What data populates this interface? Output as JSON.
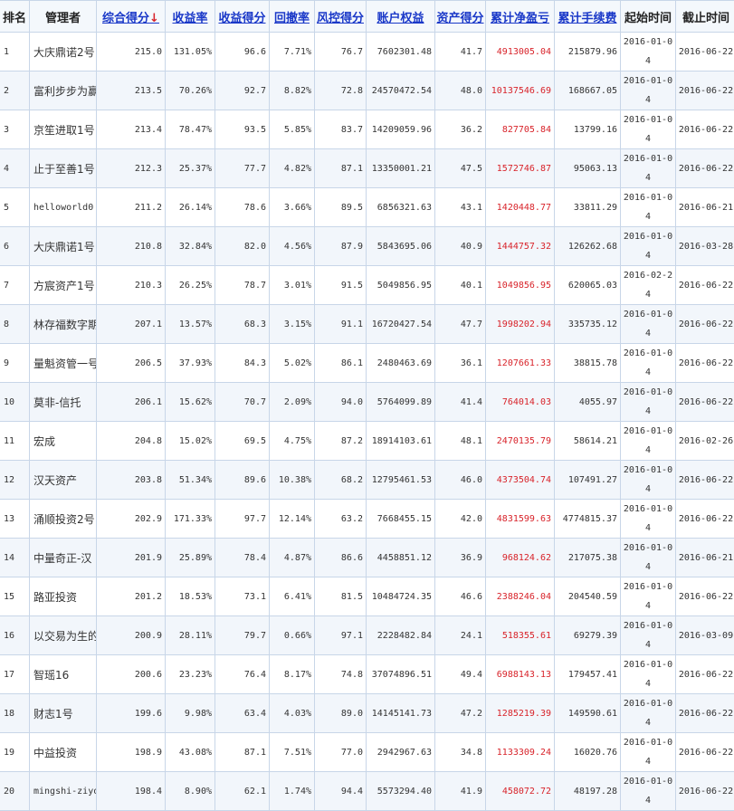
{
  "table": {
    "headers": {
      "rank": "排名",
      "manager": "管理者",
      "total_score": "综合得分",
      "return_rate": "收益率",
      "return_score": "收益得分",
      "drawdown": "回撤率",
      "risk_score": "风控得分",
      "equity": "账户权益",
      "asset_score": "资产得分",
      "pnl": "累计净盈亏",
      "fees": "累计手续费",
      "start_time": "起始时间",
      "end_time": "截止时间"
    },
    "sort_indicator": "↓",
    "rows": [
      {
        "rank": "1",
        "manager": "大庆鼎诺2号",
        "total_score": "215.0",
        "return_rate": "131.05%",
        "return_score": "96.6",
        "drawdown": "7.71%",
        "risk_score": "76.7",
        "equity": "7602301.48",
        "asset_score": "41.7",
        "pnl": "4913005.04",
        "fees": "215879.96",
        "start": "2016-01-04",
        "end": "2016-06-22"
      },
      {
        "rank": "2",
        "manager": "富利步步为赢",
        "total_score": "213.5",
        "return_rate": "70.26%",
        "return_score": "92.7",
        "drawdown": "8.82%",
        "risk_score": "72.8",
        "equity": "24570472.54",
        "asset_score": "48.0",
        "pnl": "10137546.69",
        "fees": "168667.05",
        "start": "2016-01-04",
        "end": "2016-06-22"
      },
      {
        "rank": "3",
        "manager": "京笙进取1号",
        "total_score": "213.4",
        "return_rate": "78.47%",
        "return_score": "93.5",
        "drawdown": "5.85%",
        "risk_score": "83.7",
        "equity": "14209059.96",
        "asset_score": "36.2",
        "pnl": "827705.84",
        "fees": "13799.16",
        "start": "2016-01-04",
        "end": "2016-06-22"
      },
      {
        "rank": "4",
        "manager": "止于至善1号",
        "total_score": "212.3",
        "return_rate": "25.37%",
        "return_score": "77.7",
        "drawdown": "4.82%",
        "risk_score": "87.1",
        "equity": "13350001.21",
        "asset_score": "47.5",
        "pnl": "1572746.87",
        "fees": "95063.13",
        "start": "2016-01-04",
        "end": "2016-06-22"
      },
      {
        "rank": "5",
        "manager": "helloworld0",
        "total_score": "211.2",
        "return_rate": "26.14%",
        "return_score": "78.6",
        "drawdown": "3.66%",
        "risk_score": "89.5",
        "equity": "6856321.63",
        "asset_score": "43.1",
        "pnl": "1420448.77",
        "fees": "33811.29",
        "start": "2016-01-04",
        "end": "2016-06-21"
      },
      {
        "rank": "6",
        "manager": "大庆鼎诺1号",
        "total_score": "210.8",
        "return_rate": "32.84%",
        "return_score": "82.0",
        "drawdown": "4.56%",
        "risk_score": "87.9",
        "equity": "5843695.06",
        "asset_score": "40.9",
        "pnl": "1444757.32",
        "fees": "126262.68",
        "start": "2016-01-04",
        "end": "2016-03-28"
      },
      {
        "rank": "7",
        "manager": "方宸资产1号",
        "total_score": "210.3",
        "return_rate": "26.25%",
        "return_score": "78.7",
        "drawdown": "3.01%",
        "risk_score": "91.5",
        "equity": "5049856.95",
        "asset_score": "40.1",
        "pnl": "1049856.95",
        "fees": "620065.03",
        "start": "2016-02-24",
        "end": "2016-06-22"
      },
      {
        "rank": "8",
        "manager": "林存福数字期",
        "total_score": "207.1",
        "return_rate": "13.57%",
        "return_score": "68.3",
        "drawdown": "3.15%",
        "risk_score": "91.1",
        "equity": "16720427.54",
        "asset_score": "47.7",
        "pnl": "1998202.94",
        "fees": "335735.12",
        "start": "2016-01-04",
        "end": "2016-06-22"
      },
      {
        "rank": "9",
        "manager": "量魁资管一号",
        "total_score": "206.5",
        "return_rate": "37.93%",
        "return_score": "84.3",
        "drawdown": "5.02%",
        "risk_score": "86.1",
        "equity": "2480463.69",
        "asset_score": "36.1",
        "pnl": "1207661.33",
        "fees": "38815.78",
        "start": "2016-01-04",
        "end": "2016-06-22"
      },
      {
        "rank": "10",
        "manager": "莫非-信托",
        "total_score": "206.1",
        "return_rate": "15.62%",
        "return_score": "70.7",
        "drawdown": "2.09%",
        "risk_score": "94.0",
        "equity": "5764099.89",
        "asset_score": "41.4",
        "pnl": "764014.03",
        "fees": "4055.97",
        "start": "2016-01-04",
        "end": "2016-06-22"
      },
      {
        "rank": "11",
        "manager": "宏成",
        "total_score": "204.8",
        "return_rate": "15.02%",
        "return_score": "69.5",
        "drawdown": "4.75%",
        "risk_score": "87.2",
        "equity": "18914103.61",
        "asset_score": "48.1",
        "pnl": "2470135.79",
        "fees": "58614.21",
        "start": "2016-01-04",
        "end": "2016-02-26"
      },
      {
        "rank": "12",
        "manager": "汉天资产",
        "total_score": "203.8",
        "return_rate": "51.34%",
        "return_score": "89.6",
        "drawdown": "10.38%",
        "risk_score": "68.2",
        "equity": "12795461.53",
        "asset_score": "46.0",
        "pnl": "4373504.74",
        "fees": "107491.27",
        "start": "2016-01-04",
        "end": "2016-06-22"
      },
      {
        "rank": "13",
        "manager": "涌顺投资2号",
        "total_score": "202.9",
        "return_rate": "171.33%",
        "return_score": "97.7",
        "drawdown": "12.14%",
        "risk_score": "63.2",
        "equity": "7668455.15",
        "asset_score": "42.0",
        "pnl": "4831599.63",
        "fees": "4774815.37",
        "start": "2016-01-04",
        "end": "2016-06-22"
      },
      {
        "rank": "14",
        "manager": "中量奇正-汉",
        "total_score": "201.9",
        "return_rate": "25.89%",
        "return_score": "78.4",
        "drawdown": "4.87%",
        "risk_score": "86.6",
        "equity": "4458851.12",
        "asset_score": "36.9",
        "pnl": "968124.62",
        "fees": "217075.38",
        "start": "2016-01-04",
        "end": "2016-06-21"
      },
      {
        "rank": "15",
        "manager": "路亚投资",
        "total_score": "201.2",
        "return_rate": "18.53%",
        "return_score": "73.1",
        "drawdown": "6.41%",
        "risk_score": "81.5",
        "equity": "10484724.35",
        "asset_score": "46.6",
        "pnl": "2388246.04",
        "fees": "204540.59",
        "start": "2016-01-04",
        "end": "2016-06-22"
      },
      {
        "rank": "16",
        "manager": "以交易为生的",
        "total_score": "200.9",
        "return_rate": "28.11%",
        "return_score": "79.7",
        "drawdown": "0.66%",
        "risk_score": "97.1",
        "equity": "2228482.84",
        "asset_score": "24.1",
        "pnl": "518355.61",
        "fees": "69279.39",
        "start": "2016-01-04",
        "end": "2016-03-09"
      },
      {
        "rank": "17",
        "manager": "智瑶16",
        "total_score": "200.6",
        "return_rate": "23.23%",
        "return_score": "76.4",
        "drawdown": "8.17%",
        "risk_score": "74.8",
        "equity": "37074896.51",
        "asset_score": "49.4",
        "pnl": "6988143.13",
        "fees": "179457.41",
        "start": "2016-01-04",
        "end": "2016-06-22"
      },
      {
        "rank": "18",
        "manager": "财志1号",
        "total_score": "199.6",
        "return_rate": "9.98%",
        "return_score": "63.4",
        "drawdown": "4.03%",
        "risk_score": "89.0",
        "equity": "14145141.73",
        "asset_score": "47.2",
        "pnl": "1285219.39",
        "fees": "149590.61",
        "start": "2016-01-04",
        "end": "2016-06-22"
      },
      {
        "rank": "19",
        "manager": "中益投资",
        "total_score": "198.9",
        "return_rate": "43.08%",
        "return_score": "87.1",
        "drawdown": "7.51%",
        "risk_score": "77.0",
        "equity": "2942967.63",
        "asset_score": "34.8",
        "pnl": "1133309.24",
        "fees": "16020.76",
        "start": "2016-01-04",
        "end": "2016-06-22"
      },
      {
        "rank": "20",
        "manager": "mingshi-ziyo",
        "total_score": "198.4",
        "return_rate": "8.90%",
        "return_score": "62.1",
        "drawdown": "1.74%",
        "risk_score": "94.4",
        "equity": "5573294.40",
        "asset_score": "41.9",
        "pnl": "458072.72",
        "fees": "48197.28",
        "start": "2016-01-04",
        "end": "2016-06-22"
      }
    ]
  },
  "colors": {
    "link": "#1a38c8",
    "profit": "#d8232a",
    "border": "#c8d6e8",
    "alt_row": "#f2f6fb"
  }
}
